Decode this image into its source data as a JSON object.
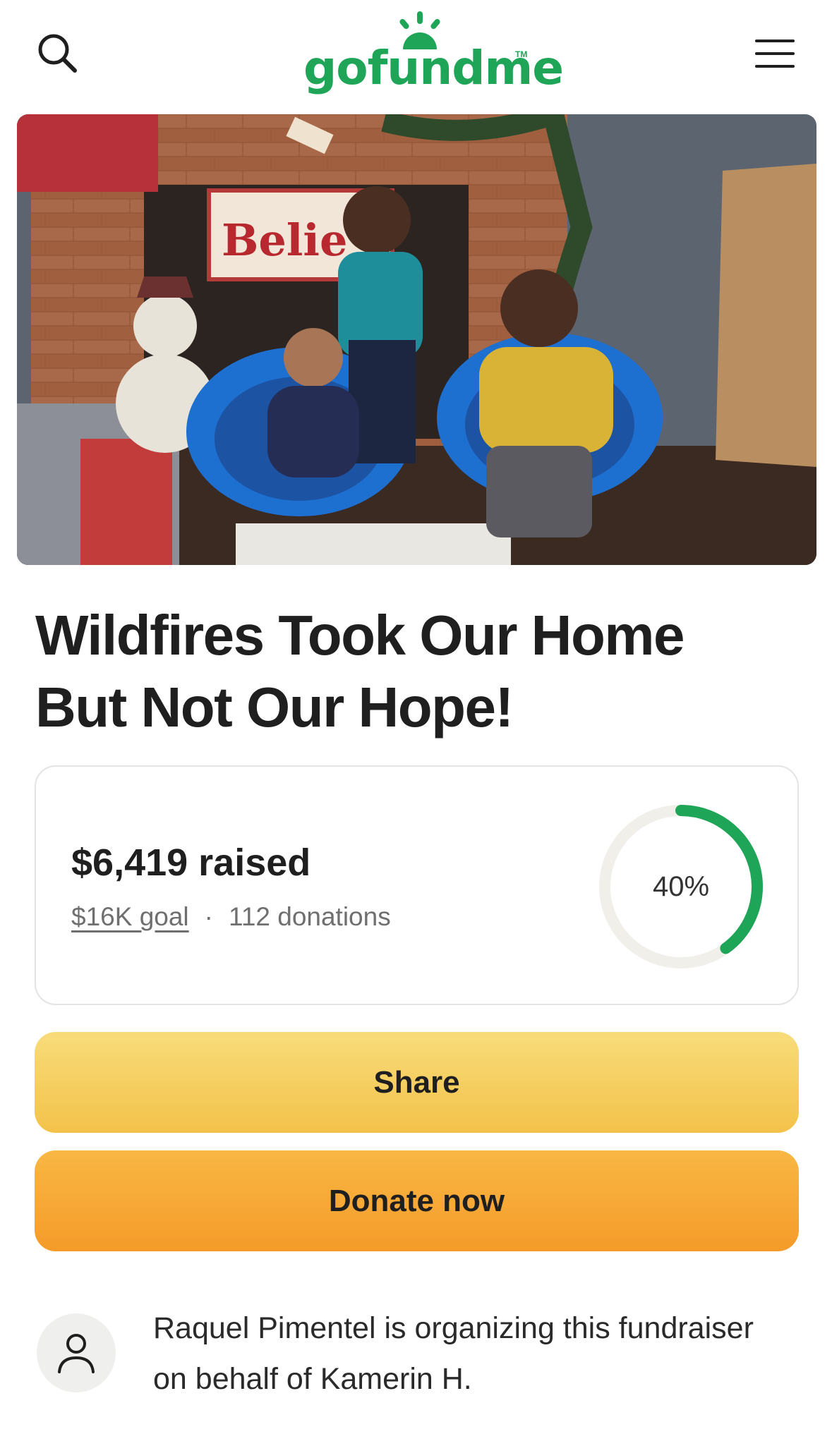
{
  "header": {
    "logo_text": "gofundme",
    "logo_tm": "TM",
    "search_icon": "search-icon",
    "menu_icon": "hamburger-menu-icon"
  },
  "hero": {
    "image": "fundraiser-photo-three-children-christmas"
  },
  "campaign": {
    "title": "Wildfires Took Our Home But Not Our Hope!"
  },
  "progress": {
    "raised": "$6,419 raised",
    "goal": "$16K goal",
    "separator": "·",
    "donations": "112 donations",
    "percent_label": "40%",
    "percent": 0.4,
    "accent_color": "#1fa557",
    "track_color": "#f0efea"
  },
  "actions": {
    "share_label": "Share",
    "donate_label": "Donate now"
  },
  "organizer": {
    "avatar_icon": "user-icon",
    "text": "Raquel Pimentel is organizing this fundraiser on behalf of Kamerin H."
  }
}
